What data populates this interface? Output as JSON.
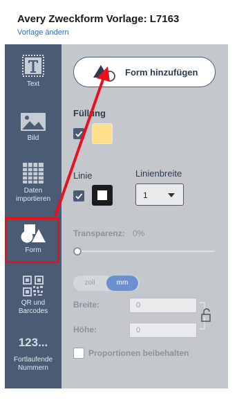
{
  "header": {
    "title": "Avery Zweckform Vorlage: L7163",
    "change_link": "Vorlage ändern"
  },
  "sidebar": {
    "items": [
      {
        "label": "Text",
        "icon": "text-icon"
      },
      {
        "label": "Bild",
        "icon": "image-icon"
      },
      {
        "label_line1": "Daten",
        "label_line2": "importieren",
        "icon": "table-icon"
      },
      {
        "label": "Form",
        "icon": "shapes-icon"
      },
      {
        "label_line1": "QR und",
        "label_line2": "Barcodes",
        "icon": "qr-code-icon"
      },
      {
        "icon_text": "123...",
        "label_line1": "Fortlaufende",
        "label_line2": "Nummern",
        "icon": "sequence-numbers-icon"
      }
    ]
  },
  "panel": {
    "add_shape_label": "Form hinzufügen",
    "fill": {
      "label": "Füllung",
      "checked": true,
      "color": "#ffe08a"
    },
    "line": {
      "label": "Linie",
      "checked": true,
      "color": "#1c1c1c"
    },
    "line_width": {
      "label": "Linienbreite",
      "value": "1"
    },
    "transparency": {
      "label": "Transparenz:",
      "value": "0%",
      "fraction": 0
    },
    "units": {
      "off_label": "zoll",
      "on_label": "mm"
    },
    "width": {
      "label": "Breite:",
      "value": "0"
    },
    "height": {
      "label": "Höhe:",
      "value": "0"
    },
    "keep_proportions": {
      "label": "Proportionen beibehalten",
      "checked": false
    }
  },
  "colors": {
    "sidebar_bg": "#4a5b73",
    "panel_bg": "#c4c8cc",
    "highlight": "#e8101a",
    "accent": "#6c8fd0"
  }
}
